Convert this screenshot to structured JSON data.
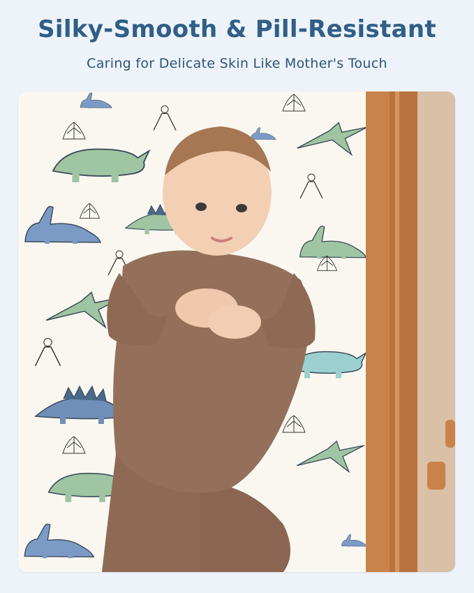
{
  "header": {
    "title": "Silky-Smooth & Pill-Resistant",
    "subtitle": "Caring for Delicate Skin Like Mother's Touch"
  },
  "theme": {
    "title_color": "#2f5f86",
    "subtitle_color": "#2b5379",
    "background": "#eef3fa",
    "sheet_background": "#faf7f1",
    "dino_green": "#9fc5a2",
    "dino_blue": "#7b9bc6",
    "dino_teal": "#9ccfcf",
    "romper": "#8e6a55",
    "crib_wood": "#c9824a",
    "carpet": "#d9c0a6"
  },
  "photo": {
    "subject": "baby-on-dinosaur-print-crib-sheet",
    "icons": [
      "dinosaur-pattern-icon",
      "crib-rail-icon"
    ]
  }
}
